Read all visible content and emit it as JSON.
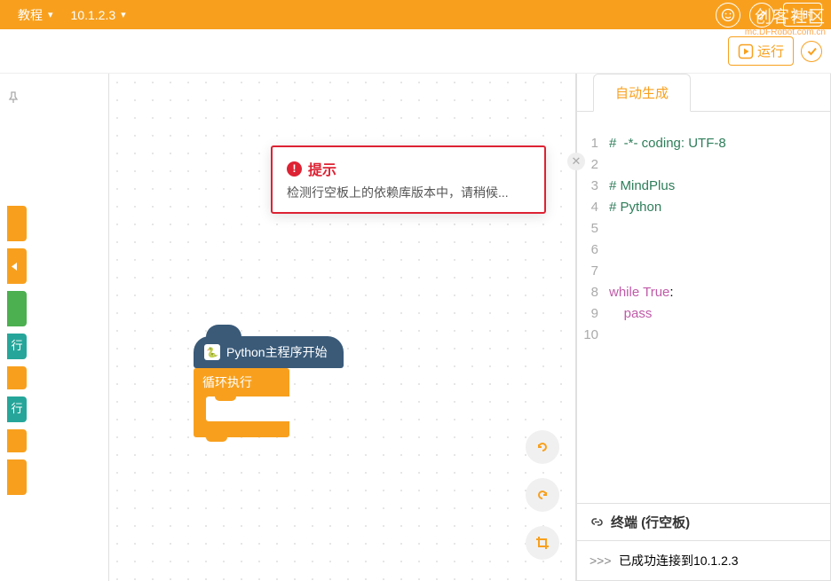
{
  "header": {
    "menu1": "教程",
    "menu2": "10.1.2.3",
    "rt_label": "实时",
    "community": "创客社区",
    "watermark_url": "mc.DFRobot.com.cn"
  },
  "subbar": {
    "run": "运行"
  },
  "sidebar": {
    "cat_labels": [
      "行",
      "行"
    ]
  },
  "blocks": {
    "hat": "Python主程序开始",
    "loop": "循环执行"
  },
  "code_tab": "自动生成",
  "code": {
    "lines": [
      {
        "n": 1,
        "cls": "comment",
        "t": "#  -*- coding: UTF-8 "
      },
      {
        "n": 2,
        "cls": "",
        "t": ""
      },
      {
        "n": 3,
        "cls": "comment",
        "t": "# MindPlus"
      },
      {
        "n": 4,
        "cls": "comment",
        "t": "# Python"
      },
      {
        "n": 5,
        "cls": "",
        "t": ""
      },
      {
        "n": 6,
        "cls": "",
        "t": ""
      },
      {
        "n": 7,
        "cls": "",
        "t": ""
      },
      {
        "n": 8,
        "cls": "while",
        "t": ""
      },
      {
        "n": 9,
        "cls": "pass",
        "t": ""
      },
      {
        "n": 10,
        "cls": "",
        "t": ""
      }
    ],
    "kw_while": "while",
    "kw_true": "True",
    "kw_pass": "pass"
  },
  "terminal": {
    "title": "终端 (行空板)",
    "prompt": ">>>",
    "msg": "已成功连接到",
    "addr": "10.1.2.3"
  },
  "toast": {
    "title": "提示",
    "body": "检测行空板上的依赖库版本中，请稍候..."
  }
}
